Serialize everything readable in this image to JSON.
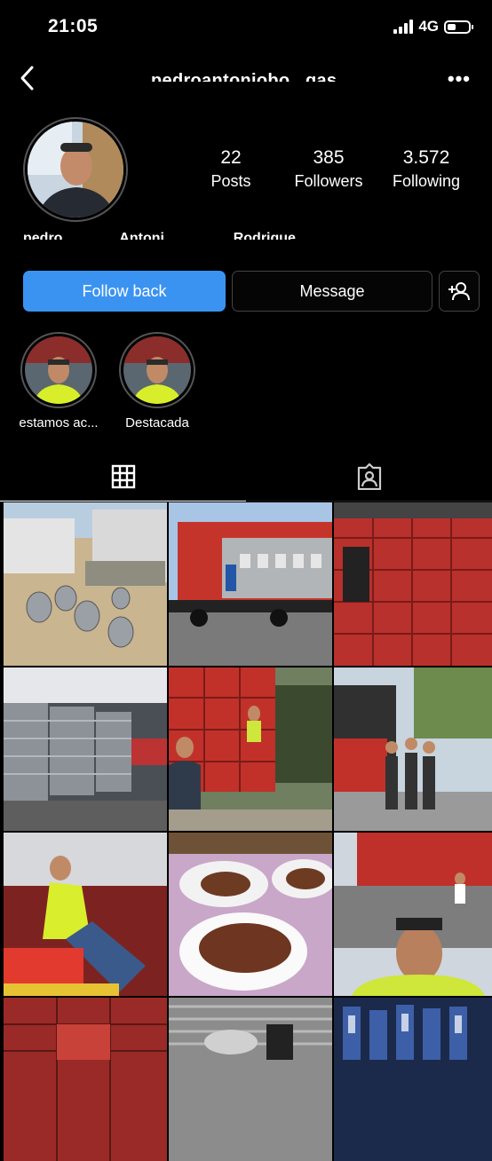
{
  "status": {
    "time": "21:05",
    "network": "4G"
  },
  "profile": {
    "username": "pedroantoniobo...gas",
    "full_name": "pedro Antoni... Rodrigue",
    "stats": [
      {
        "value": "22",
        "label": "Posts"
      },
      {
        "value": "385",
        "label": "Followers"
      },
      {
        "value": "3.572",
        "label": "Following"
      }
    ]
  },
  "actions": {
    "follow": "Follow back",
    "message": "Message"
  },
  "highlights": [
    {
      "label": "estamos ac..."
    },
    {
      "label": "Destacada"
    }
  ],
  "icons": {
    "back": "chevron-left-icon",
    "more": "more-horizontal-icon",
    "add_person": "add-person-icon",
    "grid": "grid-icon",
    "tagged": "tagged-icon"
  },
  "colors": {
    "accent": "#3b93f1",
    "background": "#000000"
  }
}
